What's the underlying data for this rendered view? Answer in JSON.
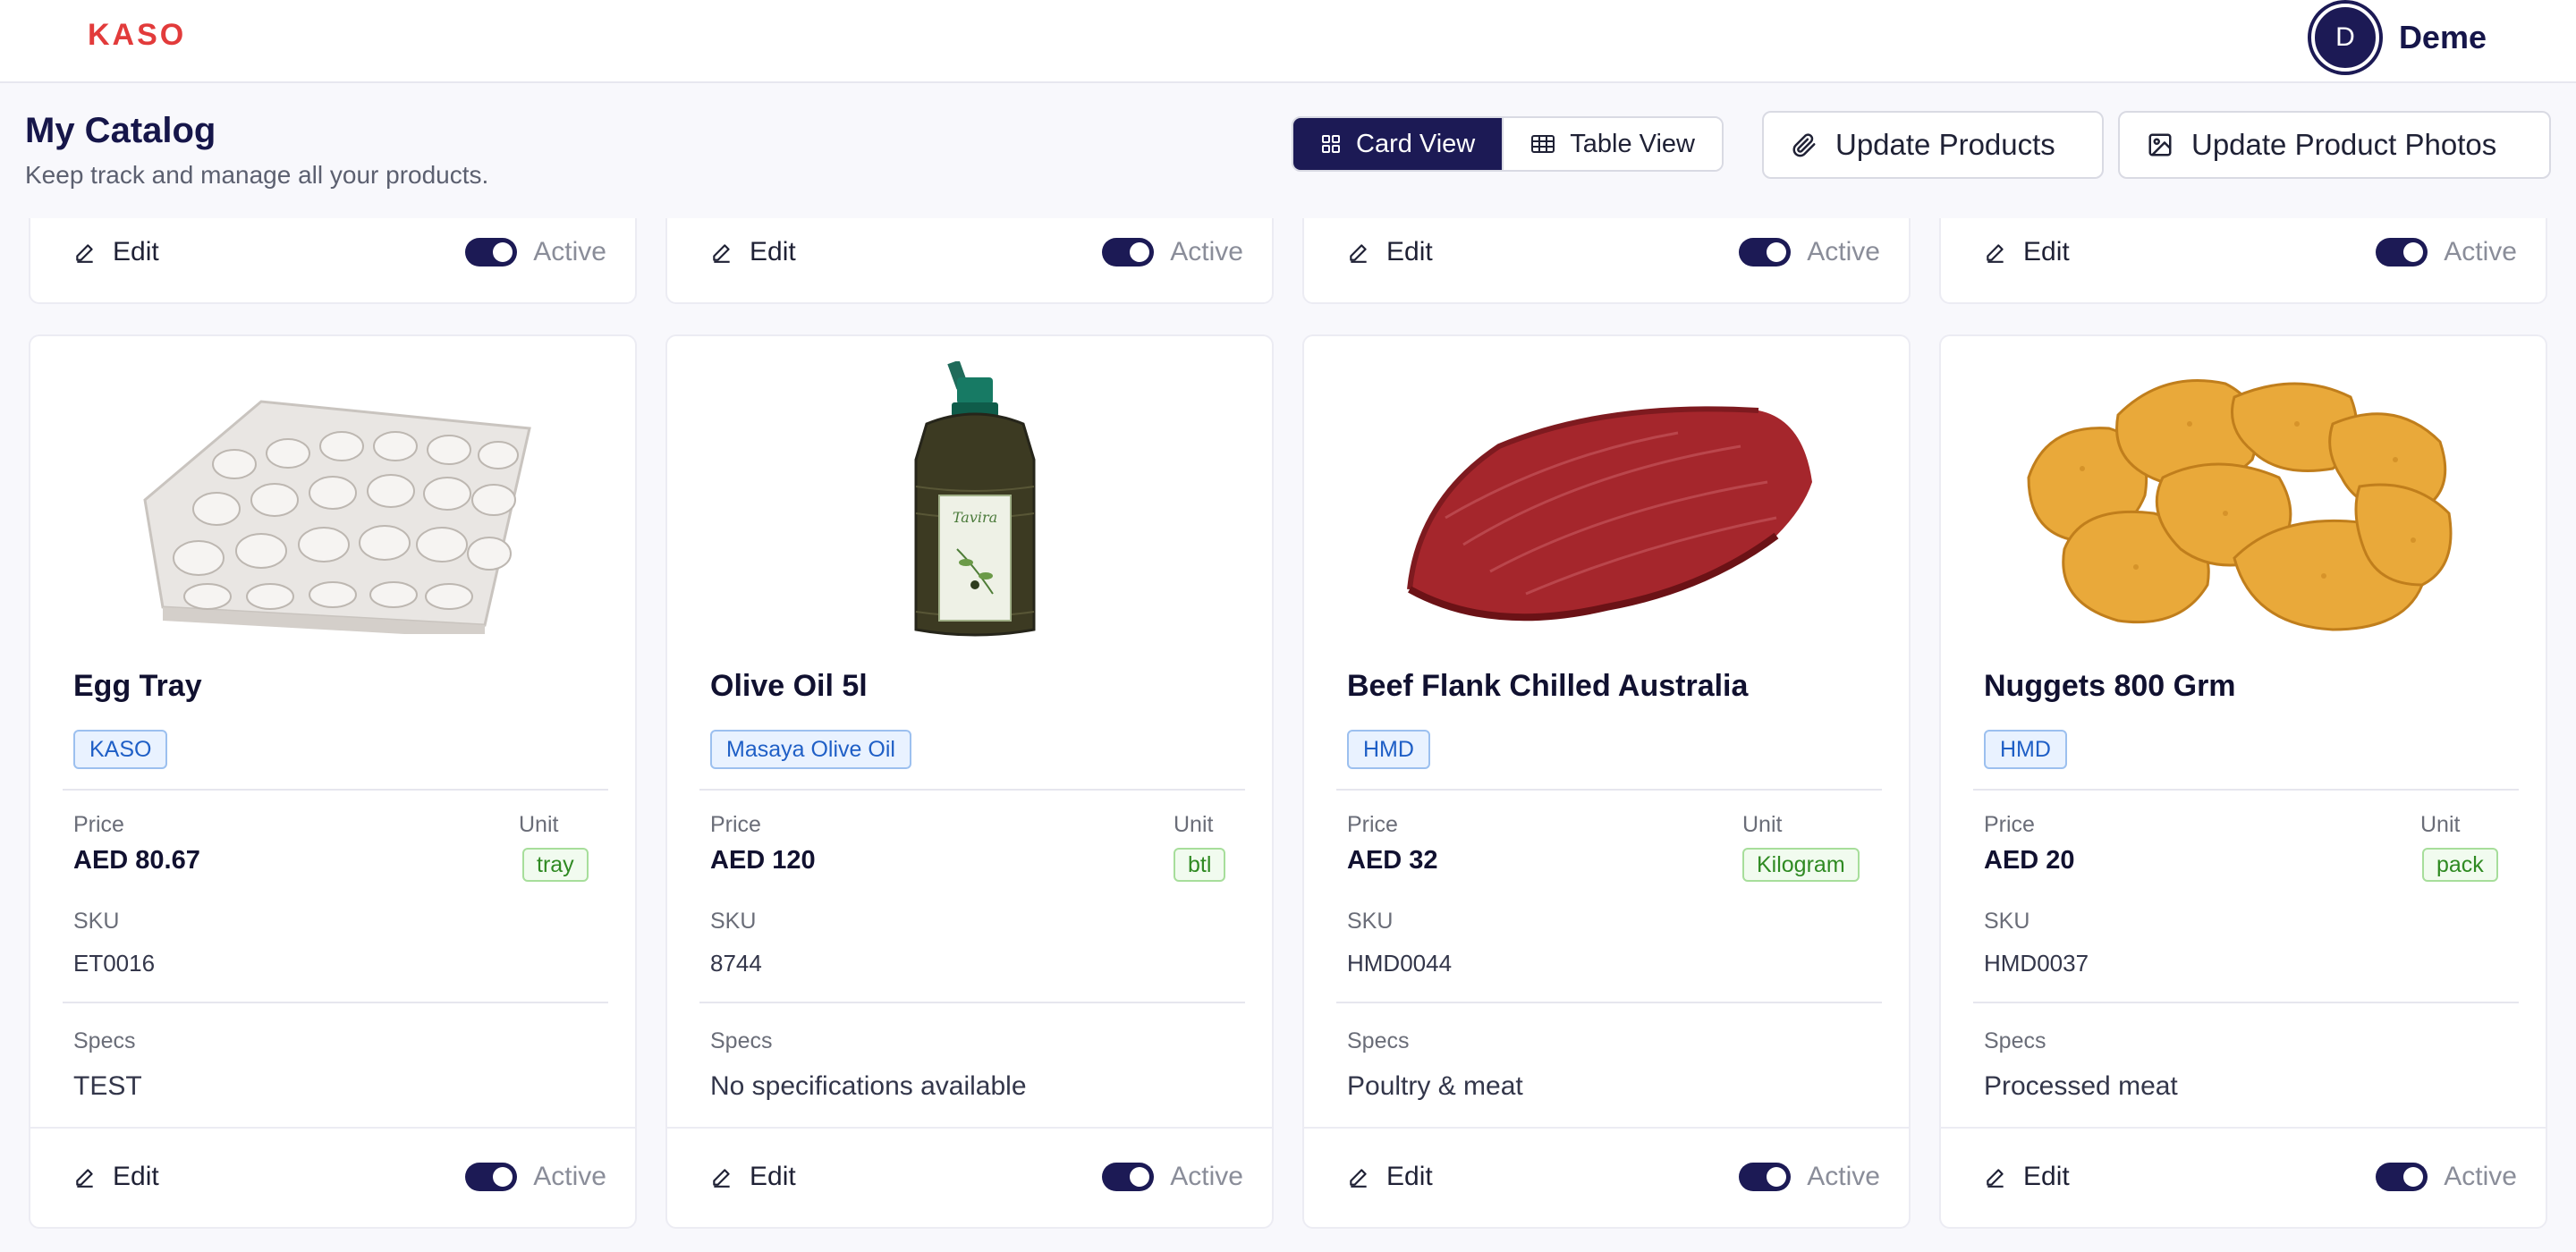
{
  "nav": {
    "logo": "KASO",
    "user_initial": "D",
    "user_name": "Deme"
  },
  "header": {
    "title": "My Catalog",
    "subtitle": "Keep track and manage all your products.",
    "card_view_label": "Card View",
    "table_view_label": "Table View",
    "update_products_label": "Update Products",
    "update_photos_label": "Update Product Photos"
  },
  "card_common": {
    "edit_label": "Edit",
    "active_label": "Active",
    "price_label": "Price",
    "unit_label": "Unit",
    "sku_label": "SKU",
    "specs_label": "Specs"
  },
  "products": [
    {
      "name": "Egg Tray",
      "brand": "KASO",
      "price": "AED 80.67",
      "unit": "tray",
      "sku": "ET0016",
      "specs": "TEST",
      "image": "egg-tray-image",
      "active": true
    },
    {
      "name": "Olive Oil 5l",
      "brand": "Masaya Olive Oil",
      "price": "AED 120",
      "unit": "btl",
      "sku": "8744",
      "specs": "No specifications available",
      "image": "olive-oil-bottle-image",
      "active": true
    },
    {
      "name": "Beef Flank Chilled Australia",
      "brand": "HMD",
      "price": "AED 32",
      "unit": "Kilogram",
      "sku": "HMD0044",
      "specs": "Poultry & meat",
      "image": "beef-flank-image",
      "active": true
    },
    {
      "name": "Nuggets 800 Grm",
      "brand": "HMD",
      "price": "AED 20",
      "unit": "pack",
      "sku": "HMD0037",
      "specs": "Processed meat",
      "image": "chicken-nuggets-image",
      "active": true
    }
  ],
  "colors": {
    "brand_red": "#e23b3b",
    "navy": "#1c1a55",
    "tag_blue": "#1f5fc6",
    "unit_green": "#2f8a22"
  }
}
